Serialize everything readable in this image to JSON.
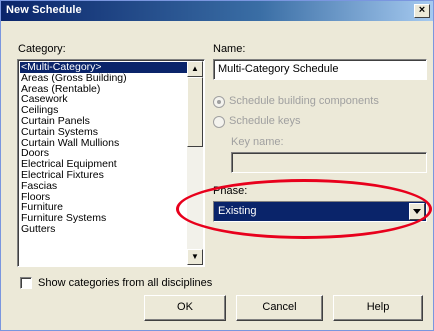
{
  "window": {
    "title": "New Schedule",
    "close_label": "×"
  },
  "category": {
    "label": "Category:",
    "selected_index": 0,
    "items": [
      "<Multi-Category>",
      "Areas (Gross Building)",
      "Areas (Rentable)",
      "Casework",
      "Ceilings",
      "Curtain Panels",
      "Curtain Systems",
      "Curtain Wall Mullions",
      "Doors",
      "Electrical Equipment",
      "Electrical Fixtures",
      "Fascias",
      "Floors",
      "Furniture",
      "Furniture Systems",
      "Gutters"
    ],
    "show_all_label": "Show categories from all disciplines",
    "show_all_checked": false
  },
  "name": {
    "label": "Name:",
    "value": "Multi-Category Schedule"
  },
  "schedule_type": {
    "building_components_label": "Schedule building components",
    "keys_label": "Schedule keys",
    "selected": "building_components",
    "key_name_label": "Key name:",
    "key_name_value": ""
  },
  "phase": {
    "label": "Phase:",
    "value": "Existing"
  },
  "buttons": {
    "ok": "OK",
    "cancel": "Cancel",
    "help": "Help"
  },
  "colors": {
    "selection": "#0a246a",
    "highlight_ellipse": "#e8001c",
    "dialog_bg": "#ece9d8"
  }
}
